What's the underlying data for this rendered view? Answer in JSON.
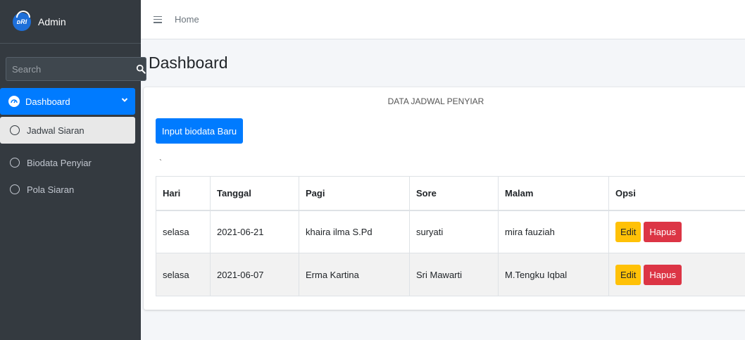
{
  "brand": {
    "logo_text": "ᴅRI",
    "name": "Admin"
  },
  "search": {
    "placeholder": "Search"
  },
  "sidebar": {
    "items": [
      {
        "label": "Dashboard"
      },
      {
        "label": "Jadwal Siaran"
      },
      {
        "label": "Biodata Penyiar"
      },
      {
        "label": "Pola Siaran"
      }
    ]
  },
  "topbar": {
    "home": "Home"
  },
  "page": {
    "title": "Dashboard"
  },
  "card": {
    "heading": "DATA JADWAL PENYIAR",
    "input_button": "Input biodata Baru",
    "tick": "`"
  },
  "table": {
    "headers": [
      "Hari",
      "Tanggal",
      "Pagi",
      "Sore",
      "Malam",
      "Opsi"
    ],
    "rows": [
      {
        "hari": "selasa",
        "tanggal": "2021-06-21",
        "pagi": "khaira ilma S.Pd",
        "sore": "suryati",
        "malam": "mira fauziah"
      },
      {
        "hari": "selasa",
        "tanggal": "2021-06-07",
        "pagi": "Erma Kartina",
        "sore": "Sri Mawarti",
        "malam": "M.Tengku Iqbal"
      }
    ],
    "edit_label": "Edit",
    "delete_label": "Hapus"
  },
  "colors": {
    "primary": "#007bff",
    "warning": "#ffc107",
    "danger": "#dc3545",
    "sidebar": "#343a40"
  }
}
